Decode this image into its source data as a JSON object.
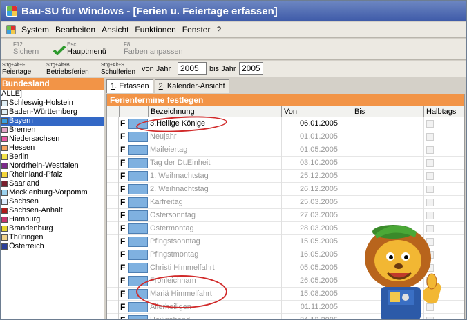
{
  "window": {
    "title": "Bau-SU für Windows - [Ferien u. Feiertage erfassen]"
  },
  "menu": [
    "System",
    "Bearbeiten",
    "Ansicht",
    "Funktionen",
    "Fenster",
    "?"
  ],
  "toolbar1": [
    {
      "key": "F12",
      "label": "Sichern",
      "enabled": false
    },
    {
      "key": "Esc",
      "label": "Hauptmenü",
      "enabled": true
    },
    {
      "key": "F8",
      "label": "Farben anpassen",
      "enabled": false
    }
  ],
  "toolbar2": {
    "feiertage": {
      "key": "Strg+Alt+F",
      "label": "Feiertage"
    },
    "betriebsferien": {
      "key": "Strg+Alt+B",
      "label": "Betriebsferien"
    },
    "schulferien": {
      "key": "Strg+Alt+S",
      "label": "Schulferien"
    },
    "von_label": "von Jahr",
    "von_value": "2005",
    "bis_label": "bis Jahr",
    "bis_value": "2005"
  },
  "bundesland": {
    "header": "Bundesland",
    "items": [
      {
        "label": "ALLE]",
        "color": "",
        "selected": false
      },
      {
        "label": "Schleswig-Holstein",
        "color": "#dfeff6",
        "selected": false
      },
      {
        "label": "Baden-Württemberg",
        "color": "#dfeff6",
        "selected": false
      },
      {
        "label": "Bayern",
        "color": "#3aa0e0",
        "selected": true
      },
      {
        "label": "Bremen",
        "color": "#e3a5c8",
        "selected": false
      },
      {
        "label": "Niedersachsen",
        "color": "#e65aa4",
        "selected": false
      },
      {
        "label": "Hessen",
        "color": "#f4a460",
        "selected": false
      },
      {
        "label": "Berlin",
        "color": "#f2e24a",
        "selected": false
      },
      {
        "label": "Nordrhein-Westfalen",
        "color": "#7a2a8a",
        "selected": false
      },
      {
        "label": "Rheinland-Pfalz",
        "color": "#f2d43a",
        "selected": false
      },
      {
        "label": "Saarland",
        "color": "#7a1f2e",
        "selected": false
      },
      {
        "label": "Mecklenburg-Vorpomm",
        "color": "#9cd2ef",
        "selected": false
      },
      {
        "label": "Sachsen",
        "color": "#ddeeff",
        "selected": false
      },
      {
        "label": "Sachsen-Anhalt",
        "color": "#b01a1a",
        "selected": false
      },
      {
        "label": "Hamburg",
        "color": "#c8366e",
        "selected": false
      },
      {
        "label": "Brandenburg",
        "color": "#e7d42e",
        "selected": false
      },
      {
        "label": "Thüringen",
        "color": "#f0d28a",
        "selected": false
      },
      {
        "label": "Österreich",
        "color": "#2a3f9a",
        "selected": false
      }
    ]
  },
  "tabs": [
    {
      "num": "1",
      "label": ". Erfassen",
      "active": true
    },
    {
      "num": "2",
      "label": ". Kalender-Ansicht",
      "active": false
    }
  ],
  "panel": {
    "header": "Ferientermine festlegen",
    "columns": {
      "bezeichnung": "Bezeichnung",
      "von": "Von",
      "bis": "Bis",
      "halbtags": "Halbtags"
    },
    "rows": [
      {
        "flag": "F",
        "name": "3.Heilige Könige",
        "von": "06.01.2005"
      },
      {
        "flag": "F",
        "name": "Neujahr",
        "von": "01.01.2005"
      },
      {
        "flag": "F",
        "name": "Maifeiertag",
        "von": "01.05.2005"
      },
      {
        "flag": "F",
        "name": "Tag der Dt.Einheit",
        "von": "03.10.2005"
      },
      {
        "flag": "F",
        "name": "1. Weihnachtstag",
        "von": "25.12.2005"
      },
      {
        "flag": "F",
        "name": "2. Weihnachtstag",
        "von": "26.12.2005"
      },
      {
        "flag": "F",
        "name": "Karfreitag",
        "von": "25.03.2005"
      },
      {
        "flag": "F",
        "name": "Ostersonntag",
        "von": "27.03.2005"
      },
      {
        "flag": "F",
        "name": "Ostermontag",
        "von": "28.03.2005"
      },
      {
        "flag": "F",
        "name": "Pfingstsonntag",
        "von": "15.05.2005"
      },
      {
        "flag": "F",
        "name": "Pfingstmontag",
        "von": "16.05.2005"
      },
      {
        "flag": "F",
        "name": "Christi Himmelfahrt",
        "von": "05.05.2005"
      },
      {
        "flag": "F",
        "name": "Fronleichnam",
        "von": "26.05.2005"
      },
      {
        "flag": "F",
        "name": "Mariä Himmelfahrt",
        "von": "15.08.2005"
      },
      {
        "flag": "F",
        "name": "Allerheiligen",
        "von": "01.11.2005"
      },
      {
        "flag": "F",
        "name": "Heiligabend",
        "von": "24.12.2005"
      }
    ]
  },
  "colors": {
    "accent": "#f29447",
    "title": "#3e5aa8",
    "selected": "#3368c6",
    "annotation": "#d12a2a"
  }
}
